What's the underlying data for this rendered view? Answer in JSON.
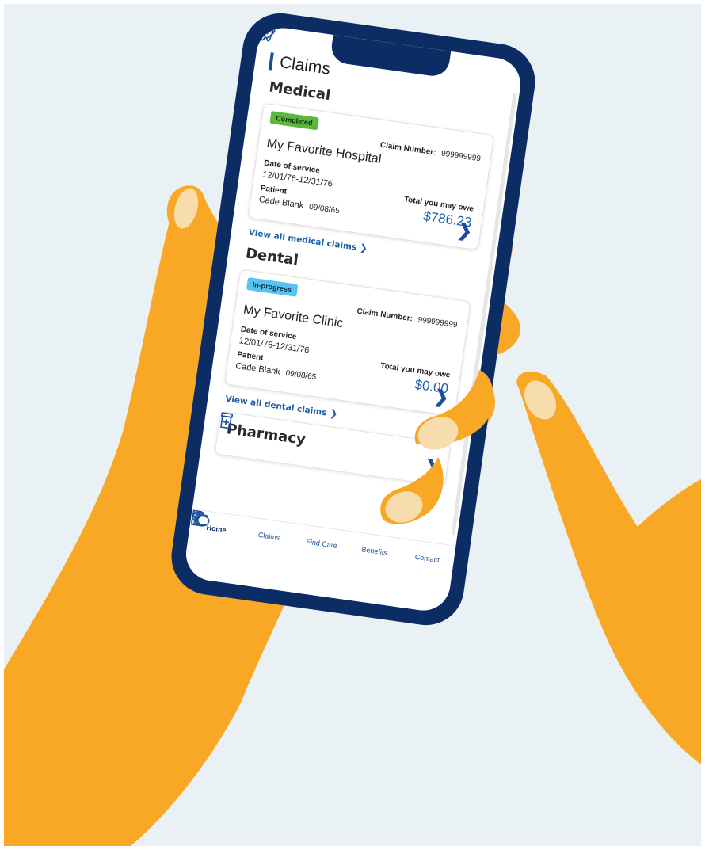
{
  "page": {
    "title": "Claims"
  },
  "medical": {
    "section_title": "Medical",
    "status": "Completed",
    "claim_number_label": "Claim Number:",
    "claim_number": "999999999",
    "provider": "My Favorite Hospital",
    "date_label": "Date of service",
    "date_value": "12/01/76-12/31/76",
    "patient_label": "Patient",
    "patient_name": "Cade Blank",
    "patient_dob": "09/08/65",
    "owe_label": "Total you may owe",
    "owe_amount": "$786.23",
    "view_all": "View all medical claims"
  },
  "dental": {
    "section_title": "Dental",
    "status": "In-progress",
    "claim_number_label": "Claim Number:",
    "claim_number": "999999999",
    "provider": "My Favorite Clinic",
    "date_label": "Date of service",
    "date_value": "12/01/76-12/31/76",
    "patient_label": "Patient",
    "patient_name": "Cade Blank",
    "patient_dob": "09/08/65",
    "owe_label": "Total you may owe",
    "owe_amount": "$0.00",
    "view_all": "View all dental claims"
  },
  "pharmacy": {
    "section_title": "Pharmacy"
  },
  "nav": {
    "home": "Home",
    "claims": "Claims",
    "find_care": "Find Care",
    "benefits": "Benefits",
    "contact": "Contact"
  },
  "colors": {
    "phone_frame": "#0c2d63",
    "accent_blue": "#1d61a8",
    "skin": "#f9a825",
    "nail": "#f7dcae",
    "background": "#e9f1f5",
    "completed_badge": "#5cb83c",
    "progress_badge": "#57c4ef"
  },
  "icons": {
    "medical": "heart-pulse-icon",
    "dental": "tooth-icon",
    "pharmacy": "pill-bottle-icon",
    "home": "home-icon",
    "claims": "dollar-document-icon",
    "find_care": "stethoscope-icon",
    "benefits": "medical-kit-icon",
    "contact": "chat-bubbles-icon",
    "chevron": "chevron-right-icon"
  }
}
